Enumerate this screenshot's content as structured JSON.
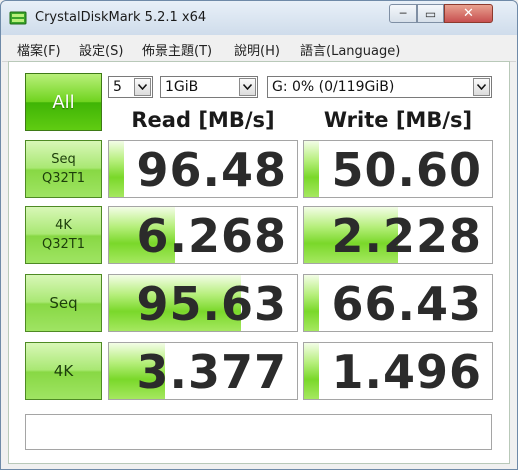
{
  "window": {
    "title": "CrystalDiskMark 5.2.1 x64",
    "min_glyph": "─",
    "max_glyph": "▭",
    "close_glyph": "✕"
  },
  "menu": [
    "檔案(F)",
    "設定(S)",
    "佈景主題(T)",
    "說明(H)",
    "語言(Language)"
  ],
  "controls": {
    "all_label": "All",
    "count_value": "5",
    "size_value": "1GiB",
    "drive_value": "G: 0% (0/119GiB)"
  },
  "headers": {
    "read": "Read [MB/s]",
    "write": "Write [MB/s]"
  },
  "rows": [
    {
      "label_line1": "Seq",
      "label_line2": "Q32T1",
      "read": "96.48",
      "write": "50.60",
      "read_fill": 0.08,
      "write_fill": 0.08
    },
    {
      "label_line1": "4K",
      "label_line2": "Q32T1",
      "read": "6.268",
      "write": "2.228",
      "read_fill": 0.35,
      "write_fill": 0.5
    },
    {
      "label_line1": "Seq",
      "label_line2": "",
      "read": "95.63",
      "write": "66.43",
      "read_fill": 0.7,
      "write_fill": 0.08
    },
    {
      "label_line1": "4K",
      "label_line2": "",
      "read": "3.377",
      "write": "1.496",
      "read_fill": 0.3,
      "write_fill": 0.08
    }
  ],
  "status_text": "",
  "colors": {
    "accent_green": "#6fd31e",
    "fill_green": "#7ad82a"
  }
}
